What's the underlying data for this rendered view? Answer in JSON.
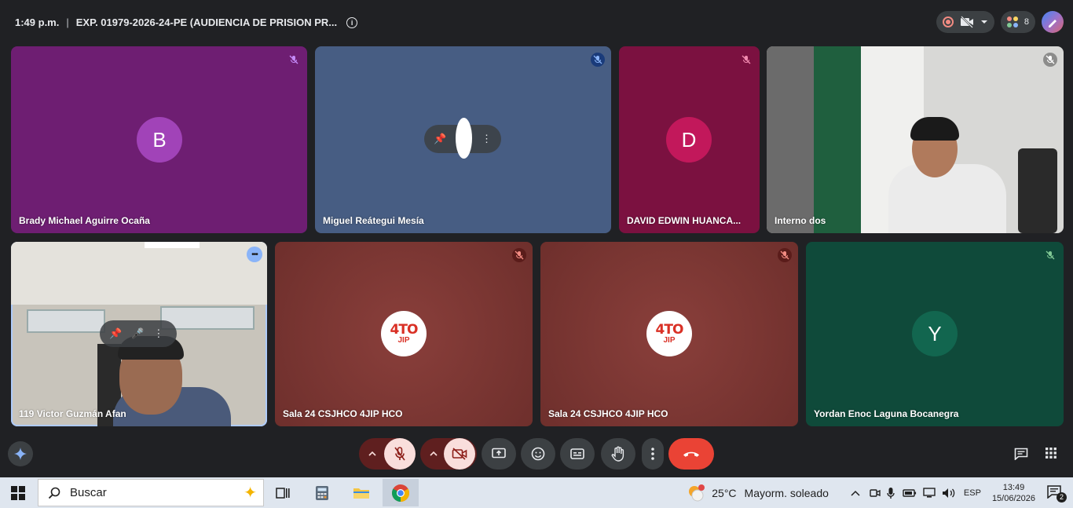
{
  "meeting": {
    "time": "1:49 p.m.",
    "separator": "|",
    "title": "EXP. 01979-2026-24-PE (AUDIENCIA DE PRISION PR...",
    "participant_count": "8",
    "info_icon": "i"
  },
  "tiles": [
    {
      "name": "Brady Michael Aguirre Ocaña",
      "initial": "B",
      "bg": "#6e1e72",
      "avatar_color": "#a143b8",
      "muted": true
    },
    {
      "name": "Miguel Reátegui Mesía",
      "initial": "",
      "bg": "#475d83",
      "muted": true
    },
    {
      "name": "DAVID EDWIN HUANCA...",
      "initial": "D",
      "bg": "#7b1140",
      "avatar_color": "#c2185b",
      "muted": true
    },
    {
      "name": "Interno dos",
      "initial": "",
      "bg": "#c9c9c9",
      "muted": true
    },
    {
      "name": "119 Victor Guzmán Afan",
      "initial": "",
      "bg": "#c8c4bb",
      "muted": false
    },
    {
      "name": "Sala 24 CSJHCO 4JIP HCO",
      "logo_line1": "4TO",
      "logo_line2": "JIP",
      "bg": "#7a3532",
      "muted": true
    },
    {
      "name": "Sala 24 CSJHCO 4JIP HCO",
      "logo_line1": "4TO",
      "logo_line2": "JIP",
      "bg": "#7a3532",
      "muted": true
    },
    {
      "name": "Yordan Enoc Laguna Bocanegra",
      "initial": "Y",
      "bg": "#0f4a3a",
      "avatar_color": "#12664f",
      "muted": true
    }
  ],
  "taskbar": {
    "search_placeholder": "Buscar",
    "temperature": "25°C",
    "weather": "Mayorm. soleado",
    "language": "ESP",
    "clock_time": "13:49",
    "clock_date": "15/06/2026",
    "notifications": "2"
  }
}
